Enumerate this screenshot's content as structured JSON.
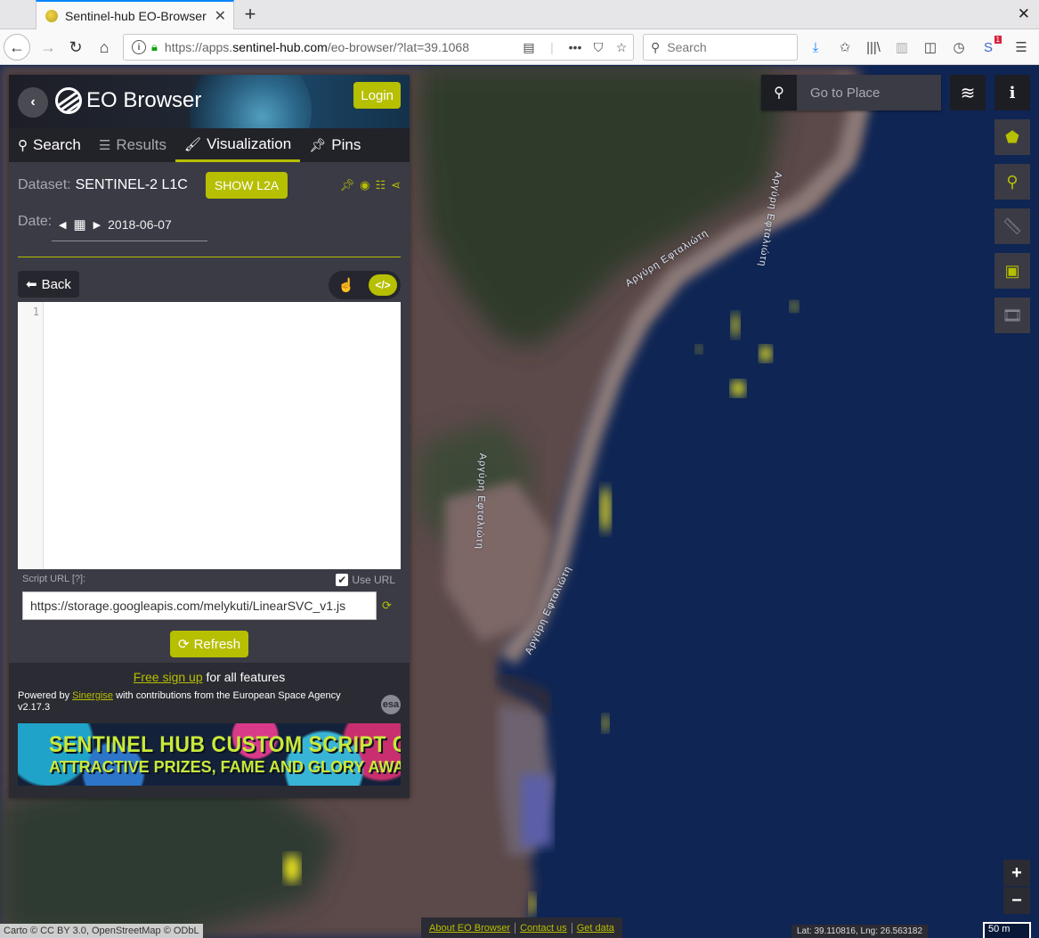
{
  "browser": {
    "tab_title": "Sentinel-hub EO-Browser",
    "url_prefix": "https://apps.",
    "url_domain": "sentinel-hub.com",
    "url_path": "/eo-browser/?lat=39.1068",
    "search_placeholder": "Search",
    "notification_count": "1"
  },
  "app": {
    "brand": "EO Browser",
    "login_label": "Login",
    "tabs": [
      {
        "label": "Search"
      },
      {
        "label": "Results"
      },
      {
        "label": "Visualization"
      },
      {
        "label": "Pins"
      }
    ],
    "dataset_label": "Dataset:",
    "dataset_value": "SENTINEL-2 L1C",
    "show_l2a_label": "SHOW L2A",
    "date_label": "Date:",
    "date_value": "2018-06-07",
    "back_label": "Back",
    "editor_line": "1",
    "script_url_label": "Script URL [?]:",
    "use_url_label": "Use URL",
    "use_url_checked": true,
    "script_url_value": "https://storage.googleapis.com/melykuti/LinearSVC_v1.js",
    "refresh_label": "Refresh",
    "signup_link": "Free sign up",
    "signup_rest": " for all features",
    "powered_prefix": "Powered by ",
    "powered_link": "Sinergise",
    "powered_suffix": " with contributions from the European Space Agency",
    "version": "v2.17.3",
    "banner_line1": "SENTINEL HUB CUSTOM SCRIPT CONTEST",
    "banner_line2": "ATTRACTIVE PRIZES, FAME AND GLORY AWAIT YOU!",
    "accent_color": "#b6bf00"
  },
  "map": {
    "goto_placeholder": "Go to Place",
    "street_labels": [
      "Αργύρη Εφταλιώτη",
      "Αργύρη Εφταλιώτη",
      "Αργύρη Εφταλιώτη",
      "Αργύρη Εφταλιώτη"
    ],
    "attribution": "Carto © CC BY 3.0, OpenStreetMap © ODbL",
    "links": [
      "About EO Browser",
      "Contact us",
      "Get data"
    ],
    "coords": "Lat: 39.110816, Lng: 26.563182",
    "scale": "50 m",
    "zoom_in": "+",
    "zoom_out": "−"
  }
}
